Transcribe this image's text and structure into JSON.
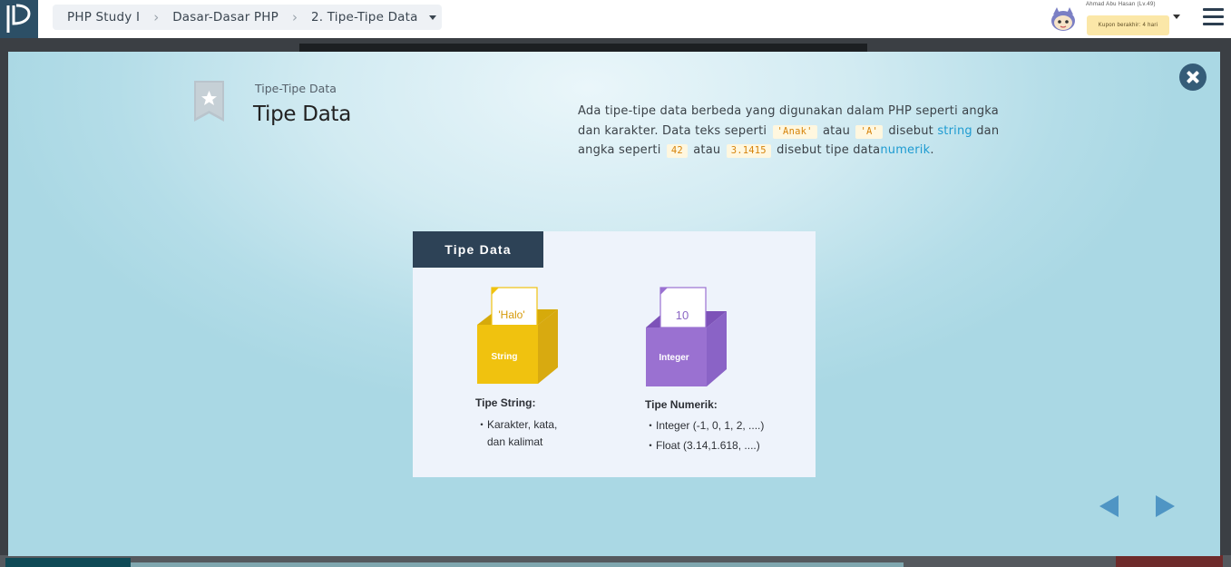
{
  "breadcrumb": {
    "course": "PHP Study I",
    "chapter": "Dasar-Dasar PHP",
    "lesson": "2. Tipe-Tipe Data"
  },
  "user": {
    "name": "Ahmad Abu Hasan (Lv.49)",
    "coupon": "Kupon berakhir: 4 hari"
  },
  "lesson": {
    "subtitle": "Tipe-Tipe Data",
    "title": "Tipe Data"
  },
  "description": {
    "p1": "Ada tipe-tipe data berbeda yang digunakan dalam PHP seperti angka dan karakter. Data teks seperti",
    "code1": "'Anak'",
    "p2": "atau",
    "code2": "'A'",
    "p3": "disebut",
    "kw1": "string",
    "p4": "dan angka seperti",
    "code3": "42",
    "p5": "atau",
    "code4": "3.1415",
    "p6": "disebut tipe data",
    "kw2": "numerik",
    "p7": "."
  },
  "slide": {
    "title": "Tipe Data",
    "string_card": "'Halo'",
    "string_box": "String",
    "integer_card": "10",
    "integer_box": "Integer",
    "string_heading": "Tipe String:",
    "string_items": [
      "・Karakter, kata,",
      "dan kalimat"
    ],
    "numeric_heading": "Tipe Numerik:",
    "numeric_items": [
      "・Integer (-1, 0, 1, 2, ....)",
      "・Float (3.14,1.618, ....)"
    ]
  },
  "colors": {
    "accent": "#1e9bd1",
    "nav": "#4f95c4",
    "dark": "#2d4256",
    "string_yellow": "#f0c20f",
    "integer_purple": "#9a71d1"
  }
}
